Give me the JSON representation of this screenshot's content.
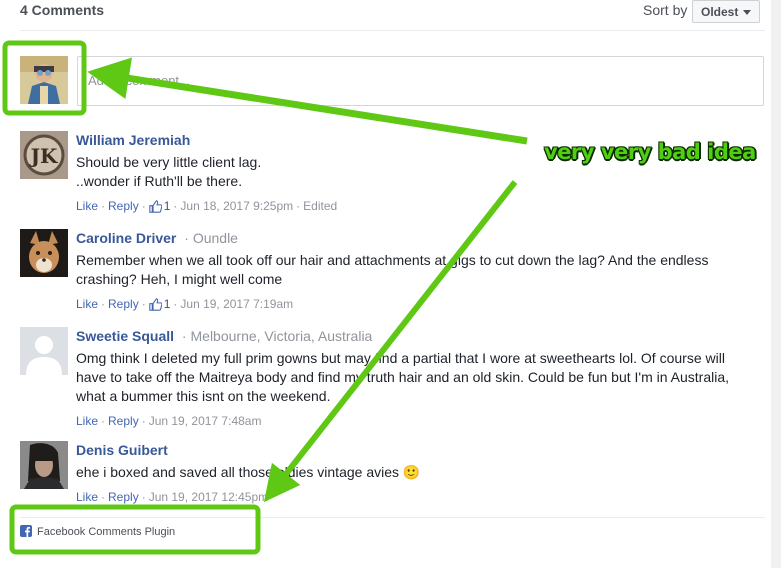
{
  "header": {
    "comment_count": "4 Comments",
    "sort_label": "Sort by",
    "sort_value": "Oldest"
  },
  "composer": {
    "placeholder": "Add a comment..."
  },
  "comments": [
    {
      "author": "William Jeremiah",
      "location": "",
      "text_lines": [
        "Should be very little client lag.",
        "..wonder if Ruth'll be there."
      ],
      "like_label": "Like",
      "reply_label": "Reply",
      "likes": "1",
      "timestamp": "Jun 18, 2017 9:25pm",
      "edited": "Edited"
    },
    {
      "author": "Caroline Driver",
      "location": "Oundle",
      "text_lines": [
        "Remember when we all took off our hair and attachments at gigs to cut down the lag? And the endless",
        "crashing? Heh, I might well come"
      ],
      "like_label": "Like",
      "reply_label": "Reply",
      "likes": "1",
      "timestamp": "Jun 19, 2017 7:19am",
      "edited": ""
    },
    {
      "author": "Sweetie Squall",
      "location": "Melbourne, Victoria, Australia",
      "text_lines": [
        "Omg think I deleted my full prim gowns but may find a partial that I wore at sweethearts lol. Of course will",
        "have to take off the Maitreya body and find my truth hair and an old skin. Could be fun but I'm in Australia,",
        "what a bummer this isnt on the weekend."
      ],
      "like_label": "Like",
      "reply_label": "Reply",
      "likes": "",
      "timestamp": "Jun 19, 2017 7:48am",
      "edited": ""
    },
    {
      "author": "Denis Guibert",
      "location": "",
      "text_lines": [
        "ehe i boxed and saved all those oldies vintage avies 🙂"
      ],
      "like_label": "Like",
      "reply_label": "Reply",
      "likes": "",
      "timestamp": "Jun 19, 2017 12:45pm",
      "edited": ""
    }
  ],
  "footer": {
    "plugin_label": "Facebook Comments Plugin"
  },
  "annotation": {
    "text": "very very bad idea",
    "color": "#5fc814"
  },
  "colors": {
    "link": "#385898",
    "meta": "#90949c",
    "annotation_green": "#5fc814"
  }
}
